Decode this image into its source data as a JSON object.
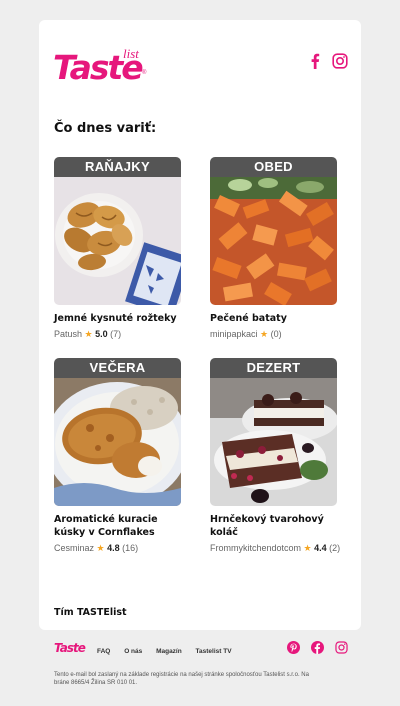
{
  "brand": {
    "logo_main": "Taste",
    "logo_sub": "list",
    "logo_reg": "®",
    "accent": "#e6177c"
  },
  "header": {
    "social": [
      "facebook-icon",
      "instagram-icon"
    ]
  },
  "main": {
    "heading": "Čo dnes variť:",
    "recipes": [
      {
        "category": "RAŇAJKY",
        "title": "Jemné kysnuté rožteky",
        "author": "Patush",
        "rating": "5.0",
        "reviews": "(7)"
      },
      {
        "category": "OBED",
        "title": "Pečené bataty",
        "author": "minipapkaci",
        "rating": "",
        "reviews": "(0)"
      },
      {
        "category": "VEČERA",
        "title": "Aromatické kuracie kúsky v Cornflakes",
        "author": "Cesminaz",
        "rating": "4.8",
        "reviews": "(16)"
      },
      {
        "category": "DEZERT",
        "title": "Hrnčekový tvarohový koláč",
        "author": "Frommykitchendotcom",
        "rating": "4.4",
        "reviews": "(2)"
      }
    ],
    "signature": "Tím TASTElist"
  },
  "footer": {
    "logo": "Taste",
    "links": [
      "FAQ",
      "O nás",
      "Magazín",
      "Tastelist TV"
    ],
    "social": [
      "pinterest-icon",
      "facebook-icon",
      "instagram-icon"
    ],
    "note": "Tento e-mail bol zaslaný na základe registrácie na našej stránke spoločnosťou Tastelist s.r.o. Na bráne 8665/4 Žilina SR 010 01."
  }
}
